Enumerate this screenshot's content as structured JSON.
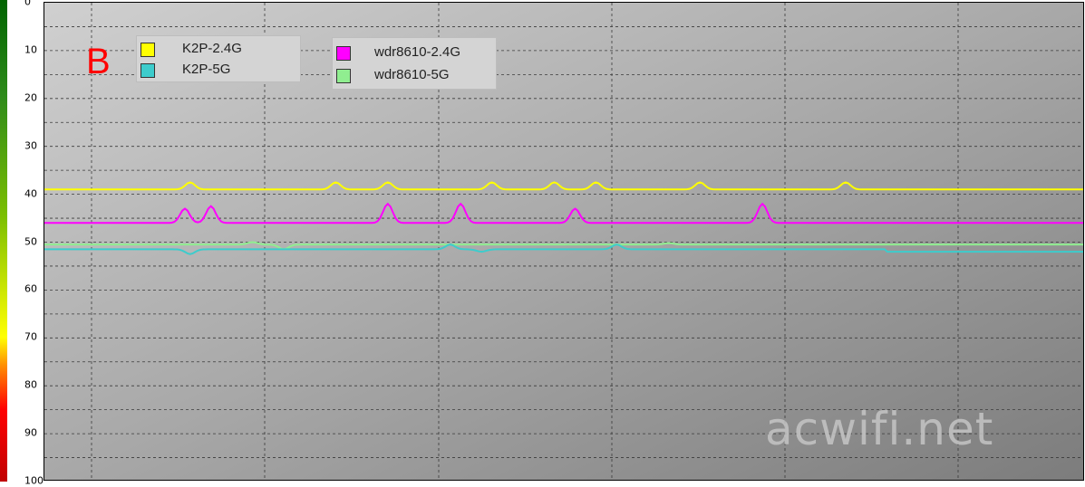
{
  "chart_data": {
    "type": "line",
    "title": "",
    "xlabel": "",
    "ylabel": "",
    "ylim": [
      0,
      100
    ],
    "y_inverted": true,
    "y_ticks": [
      0,
      10,
      20,
      30,
      40,
      50,
      60,
      70,
      80,
      90,
      100
    ],
    "grid": true,
    "legend_position": "top-left",
    "annotation": "B",
    "watermark": "acwifi.net",
    "x_range": [
      0,
      100
    ],
    "series": [
      {
        "name": "K2P-2.4G",
        "color": "#ffff00",
        "baseline": 39,
        "bumps": [
          [
            14,
            -1.5
          ],
          [
            28,
            -1.5
          ],
          [
            33,
            -1.5
          ],
          [
            43,
            -1.5
          ],
          [
            49,
            -1.5
          ],
          [
            53,
            -1.5
          ],
          [
            63,
            -1.5
          ],
          [
            77,
            -1.5
          ]
        ]
      },
      {
        "name": "K2P-5G",
        "color": "#3dcccc",
        "baseline": 51.5,
        "bumps": [
          [
            14,
            1
          ],
          [
            39,
            -1
          ],
          [
            42,
            0.5
          ],
          [
            55,
            -1
          ]
        ],
        "level_change": [
          [
            81,
            52
          ]
        ]
      },
      {
        "name": "wdr8610-2.4G",
        "color": "#ff00ff",
        "baseline": 46,
        "bumps": [
          [
            13.5,
            -3
          ],
          [
            16,
            -3.5
          ],
          [
            33,
            -4
          ],
          [
            40,
            -4
          ],
          [
            51,
            -3
          ],
          [
            69,
            -4
          ]
        ]
      },
      {
        "name": "wdr8610-5G",
        "color": "#90ee90",
        "baseline": 50.5,
        "bumps": [
          [
            20,
            -0.5
          ],
          [
            23,
            1
          ],
          [
            60,
            -0.3
          ]
        ]
      }
    ]
  }
}
